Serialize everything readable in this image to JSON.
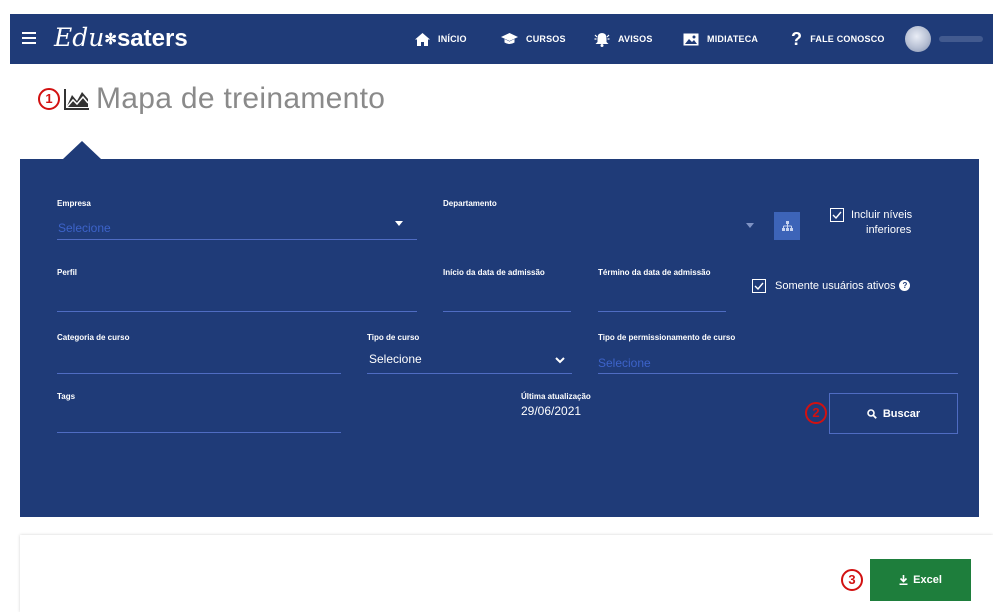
{
  "nav": {
    "logo_cursive": "Edu",
    "logo_mark": "✻",
    "logo_rest": "saters",
    "items": [
      {
        "label": "INÍCIO",
        "icon": "home-icon"
      },
      {
        "label": "CURSOS",
        "icon": "graduation-cap-icon"
      },
      {
        "label": "AVISOS",
        "icon": "bell-icon"
      },
      {
        "label": "MIDIATECA",
        "icon": "image-icon"
      },
      {
        "label": "FALE CONOSCO",
        "icon": "question-icon"
      }
    ]
  },
  "page": {
    "step1": "1",
    "title": "Mapa de treinamento"
  },
  "filters": {
    "empresa": {
      "label": "Empresa",
      "placeholder": "Selecione"
    },
    "departamento": {
      "label": "Departamento"
    },
    "incluir_niveis": {
      "label_line1": "Incluir níveis",
      "label_line2": "inferiores",
      "checked": true
    },
    "perfil": {
      "label": "Perfil"
    },
    "inicio_admissao": {
      "label": "Início da data de admissão"
    },
    "termino_admissao": {
      "label": "Término da data de admissão"
    },
    "somente_ativos": {
      "label": "Somente usuários ativos",
      "checked": true
    },
    "categoria": {
      "label": "Categoria de curso"
    },
    "tipo_curso": {
      "label": "Tipo de curso",
      "value": "Selecione"
    },
    "tipo_permissionamento": {
      "label": "Tipo de permissionamento de curso",
      "placeholder": "Selecione"
    },
    "tags": {
      "label": "Tags"
    }
  },
  "update": {
    "label": "Última atualização",
    "value": "29/06/2021"
  },
  "actions": {
    "step2": "2",
    "search_label": "Buscar",
    "step3": "3",
    "excel_label": "Excel"
  },
  "colors": {
    "navy": "#1f3b78",
    "accent_blue": "#3d64b8",
    "excel_green": "#1e7e3c",
    "marker_red": "#d21111"
  }
}
